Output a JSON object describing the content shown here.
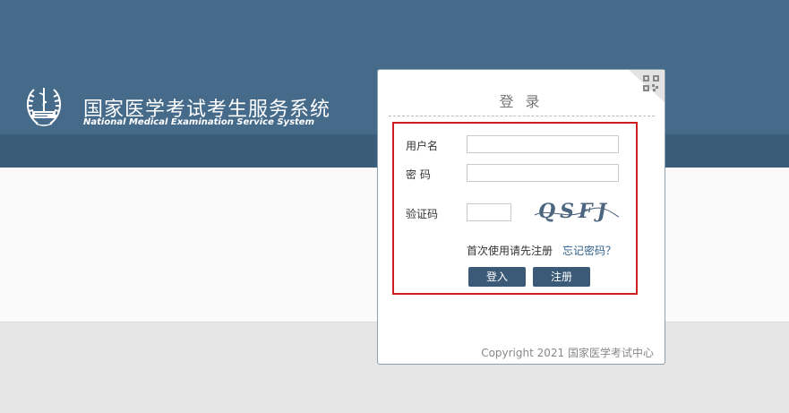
{
  "header": {
    "title": "国家医学考试考生服务系统",
    "subtitle": "National Medical Examination Service System"
  },
  "login": {
    "title": "登 录",
    "username_label": "用户名",
    "username_value": "",
    "password_label": "密 码",
    "password_value": "",
    "captcha_label": "验证码",
    "captcha_value": "",
    "captcha_image_text": "QSFJ",
    "first_use_text": "首次使用请先注册",
    "forgot_link": "忘记密码？",
    "login_button": "登入",
    "register_button": "注册"
  },
  "footer": {
    "copyright": "Copyright 2021 国家医学考试中心"
  },
  "colors": {
    "header_bg": "#456a8a",
    "header_band": "#3b5c79",
    "button_bg": "#3b5a78",
    "highlight_border": "#cc2020",
    "link": "#2f5f8a"
  }
}
